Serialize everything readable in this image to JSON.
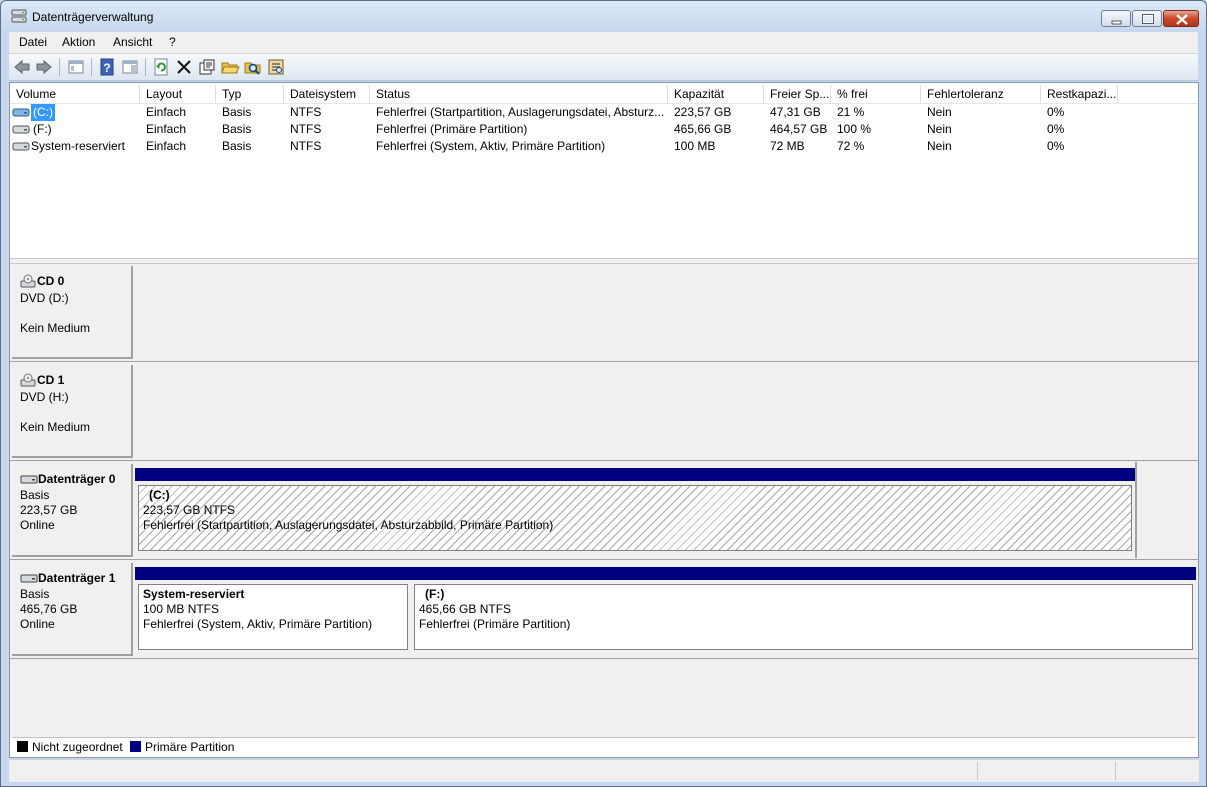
{
  "window": {
    "title": "Datenträgerverwaltung"
  },
  "menu": [
    {
      "key": "datei",
      "label": "Datei"
    },
    {
      "key": "aktion",
      "label": "Aktion"
    },
    {
      "key": "ansicht",
      "label": "Ansicht"
    },
    {
      "key": "help",
      "label": "?"
    }
  ],
  "toolbar": {
    "icons": [
      "back-icon",
      "forward-icon",
      "show-hide-tree-icon",
      "help-icon",
      "properties-pane-icon",
      "refresh-icon",
      "delete-icon",
      "properties-icon",
      "open-icon",
      "explore-icon",
      "rescan-icon"
    ]
  },
  "volumes": {
    "columns": [
      "Volume",
      "Layout",
      "Typ",
      "Dateisystem",
      "Status",
      "Kapazität",
      "Freier Sp...",
      "% frei",
      "Fehlertoleranz",
      "Restkapazi..."
    ],
    "rows": [
      {
        "volume": "(C:)",
        "layout": "Einfach",
        "typ": "Basis",
        "fs": "NTFS",
        "status": "Fehlerfrei (Startpartition, Auslagerungsdatei, Absturz...",
        "kap": "223,57 GB",
        "frei": "47,31 GB",
        "pct": "21 %",
        "ft": "Nein",
        "rest": "0%"
      },
      {
        "volume": "(F:)",
        "layout": "Einfach",
        "typ": "Basis",
        "fs": "NTFS",
        "status": "Fehlerfrei (Primäre Partition)",
        "kap": "465,66 GB",
        "frei": "464,57 GB",
        "pct": "100 %",
        "ft": "Nein",
        "rest": "0%"
      },
      {
        "volume": "System-reserviert",
        "layout": "Einfach",
        "typ": "Basis",
        "fs": "NTFS",
        "status": "Fehlerfrei (System, Aktiv, Primäre Partition)",
        "kap": "100 MB",
        "frei": "72 MB",
        "pct": "72 %",
        "ft": "Nein",
        "rest": "0%"
      }
    ]
  },
  "disks": {
    "cd0": {
      "name": "CD 0",
      "type": "DVD (D:)",
      "media": "Kein Medium"
    },
    "cd1": {
      "name": "CD 1",
      "type": "DVD (H:)",
      "media": "Kein Medium"
    },
    "disk0": {
      "name": "Datenträger 0",
      "type": "Basis",
      "size": "223,57 GB",
      "state": "Online",
      "partitions": [
        {
          "name": "(C:)",
          "size": "223,57 GB NTFS",
          "status": "Fehlerfrei (Startpartition, Auslagerungsdatei, Absturzabbild, Primäre Partition)"
        }
      ]
    },
    "disk1": {
      "name": "Datenträger 1",
      "type": "Basis",
      "size": "465,76 GB",
      "state": "Online",
      "partitions": [
        {
          "name": "System-reserviert",
          "size": "100 MB NTFS",
          "status": "Fehlerfrei (System, Aktiv, Primäre Partition)"
        },
        {
          "name": "(F:)",
          "size": "465,66 GB NTFS",
          "status": "Fehlerfrei (Primäre Partition)"
        }
      ]
    }
  },
  "legend": [
    {
      "label": "Nicht zugeordnet",
      "color": "#000000"
    },
    {
      "label": "Primäre Partition",
      "color": "#000080"
    }
  ]
}
